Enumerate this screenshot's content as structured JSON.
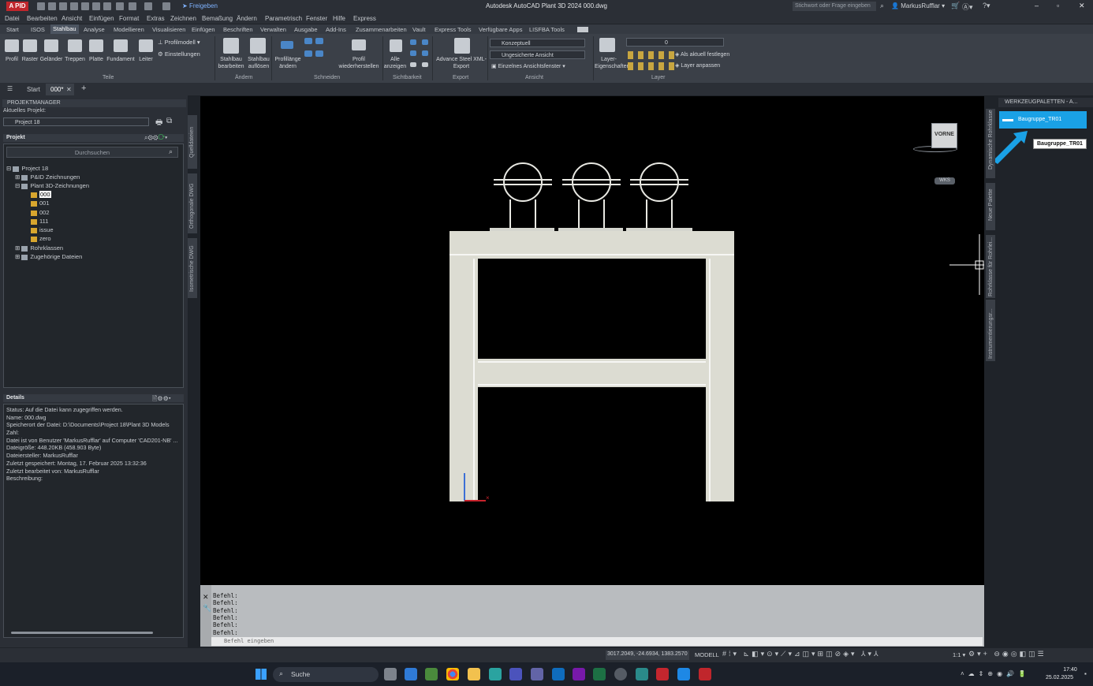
{
  "app": {
    "logo_text": "A PID",
    "title": "Autodesk AutoCAD Plant 3D 2024    000.dwg",
    "share_label": "Freigeben",
    "search_placeholder": "Stichwort oder Frage eingeben",
    "user": "MarkusRufflar"
  },
  "menu": [
    "Datei",
    "Bearbeiten",
    "Ansicht",
    "Einfügen",
    "Format",
    "Extras",
    "Zeichnen",
    "Bemaßung",
    "Ändern",
    "Parametrisch",
    "Fenster",
    "Hilfe",
    "Express"
  ],
  "ribbon_tabs": [
    "Start",
    "ISOS",
    "Stahlbau",
    "Analyse",
    "Modellieren",
    "Visualisieren",
    "Einfügen",
    "Beschriften",
    "Verwalten",
    "Ausgabe",
    "Add-Ins",
    "Zusammenarbeiten",
    "Vault",
    "Express Tools",
    "Verfügbare Apps",
    "LISFBA Tools"
  ],
  "ribbon_active_tab": "Stahlbau",
  "ribbon": {
    "teile": {
      "title": "Teile",
      "buttons": [
        "Profil",
        "Raster",
        "Geländer",
        "Treppen",
        "Platte",
        "Fundament",
        "Leiter"
      ],
      "small": [
        "Profilmodell",
        "Einstellungen"
      ]
    },
    "aendern": {
      "title": "Ändern",
      "buttons": [
        "Stahlbau\nbearbeiten",
        "Stahlbau\nauflösen"
      ]
    },
    "schneiden": {
      "title": "Schneiden",
      "buttons": [
        "Profillänge\nändern",
        "Profil\nwiederherstellen"
      ]
    },
    "sichtbarkeit": {
      "title": "Sichtbarkeit",
      "buttons": [
        "Alle\nanzeigen"
      ]
    },
    "export": {
      "title": "Export",
      "buttons": [
        "Advance Steel XML-\nExport"
      ]
    },
    "ansicht": {
      "title": "Ansicht",
      "combo1": "Konzeptuell",
      "combo2": "Ungesicherte Ansicht",
      "item3": "Einzelnes Ansichtsfenster"
    },
    "layer": {
      "title": "Layer",
      "button": "Layer-\nEigenschaften",
      "combo": "0",
      "item1": "Als aktuell festlegen",
      "item2": "Layer anpassen"
    }
  },
  "doc_tabs": {
    "start": "Start",
    "active": "000*"
  },
  "project_manager": {
    "header": "PROJEKTMANAGER",
    "current_project_label": "Aktuelles Projekt:",
    "current_project": "Project 18",
    "project_section": "Projekt",
    "search_placeholder": "Durchsuchen",
    "tree": [
      {
        "label": "Project 18",
        "level": 0,
        "icon": "project"
      },
      {
        "label": "P&ID Zeichnungen",
        "level": 1,
        "icon": "folder"
      },
      {
        "label": "Plant 3D-Zeichnungen",
        "level": 1,
        "icon": "folder"
      },
      {
        "label": "000",
        "level": 2,
        "icon": "dwg",
        "selected": true
      },
      {
        "label": "001",
        "level": 2,
        "icon": "dwg"
      },
      {
        "label": "002",
        "level": 2,
        "icon": "dwg"
      },
      {
        "label": "111",
        "level": 2,
        "icon": "dwg"
      },
      {
        "label": "issue",
        "level": 2,
        "icon": "dwg"
      },
      {
        "label": "zero",
        "level": 2,
        "icon": "dwg"
      },
      {
        "label": "Rohrklassen",
        "level": 1,
        "icon": "folder"
      },
      {
        "label": "Zugehörige Dateien",
        "level": 1,
        "icon": "folder"
      }
    ],
    "details_header": "Details",
    "details": [
      "Status: Auf die Datei kann zugegriffen werden.",
      "Name: 000.dwg",
      "Speicherort der Datei: D:\\Documents\\Project 18\\Plant 3D Models",
      "Zahl:",
      "Datei ist von Benutzer 'MarkusRufflar' auf Computer 'CAD201-NB' ...",
      "Dateigröße: 448.20KB (458.903 Byte)",
      "Dateiersteller: MarkusRufflar",
      "Zuletzt gespeichert: Montag, 17. Februar 2025 13:32:36",
      "Zuletzt bearbeitet von: MarkusRufflar",
      "Beschreibung:"
    ],
    "side_tabs": [
      "Quelldateien",
      "Orthogonale DWG",
      "Isometrische DWG"
    ]
  },
  "viewcube": {
    "face": "VORNE",
    "wcs": "WKS"
  },
  "command": {
    "lines": [
      "Befehl:",
      "Befehl:",
      "Befehl:",
      "Befehl:",
      "Befehl:",
      "Befehl:"
    ],
    "input_placeholder": "Befehl eingeben"
  },
  "tool_palette": {
    "title": "WERKZEUGPALETTEN - A...",
    "item": "Baugruppe_TR01",
    "tooltip": "Baugruppe_TR01",
    "side_tabs": [
      "Dynamische Rohrklasse",
      "Neue Palette",
      "Rohrklasse für Rohrlei...",
      "Instrumentierungsr..."
    ]
  },
  "status_bar": {
    "coords": "3017.2049, -24.6934, 1383.2570",
    "model": "MODELL",
    "scale": "1:1"
  },
  "taskbar": {
    "search": "Suche",
    "time": "17:40",
    "date": "25.02.2025"
  }
}
